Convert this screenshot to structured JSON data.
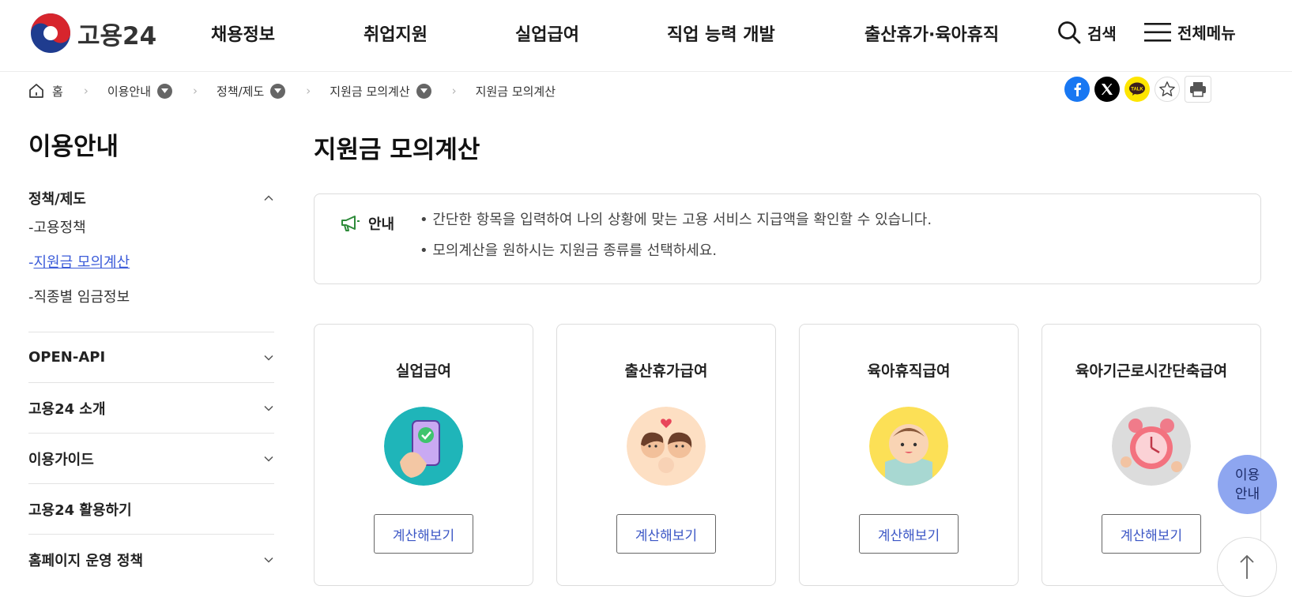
{
  "header": {
    "logo_text": "고용24",
    "nav": [
      "채용정보",
      "취업지원",
      "실업급여",
      "직업 능력 개발",
      "출산휴가·육아휴직"
    ],
    "search_label": "검색",
    "menu_label": "전체메뉴"
  },
  "breadcrumb": {
    "home": "홈",
    "items": [
      "이용안내",
      "정책/제도",
      "지원금 모의계산"
    ],
    "current": "지원금 모의계산"
  },
  "sidebar": {
    "title": "이용안내",
    "groups": [
      {
        "label": "정책/제도",
        "expanded": true,
        "items": [
          {
            "label": "고용정책",
            "active": false
          },
          {
            "label": "지원금 모의계산",
            "active": true
          },
          {
            "label": "직종별 임금정보",
            "active": false
          }
        ]
      },
      {
        "label": "OPEN-API",
        "expanded": false
      },
      {
        "label": "고용24 소개",
        "expanded": false
      },
      {
        "label": "이용가이드",
        "expanded": false
      },
      {
        "label": "고용24 활용하기",
        "expanded": false
      },
      {
        "label": "홈페이지 운영 정책",
        "expanded": false
      }
    ]
  },
  "main": {
    "title": "지원금 모의계산",
    "notice": {
      "label": "안내",
      "lines": [
        "간단한 항목을 입력하여 나의 상황에 맞는 고용 서비스 지급액을 확인할 수 있습니다.",
        "모의계산을 원하시는 지원금 종류를 선택하세요."
      ]
    },
    "cards": [
      {
        "title": "실업급여",
        "button": "계산해보기"
      },
      {
        "title": "출산휴가급여",
        "button": "계산해보기"
      },
      {
        "title": "육아휴직급여",
        "button": "계산해보기"
      },
      {
        "title": "육아기근로시간단축급여",
        "button": "계산해보기"
      }
    ]
  },
  "floating": {
    "info_line1": "이용",
    "info_line2": "안내"
  },
  "colors": {
    "accent": "#3b5bd9",
    "float_bg": "#8ea6f0",
    "facebook": "#1877f2",
    "kakao": "#fee500"
  }
}
